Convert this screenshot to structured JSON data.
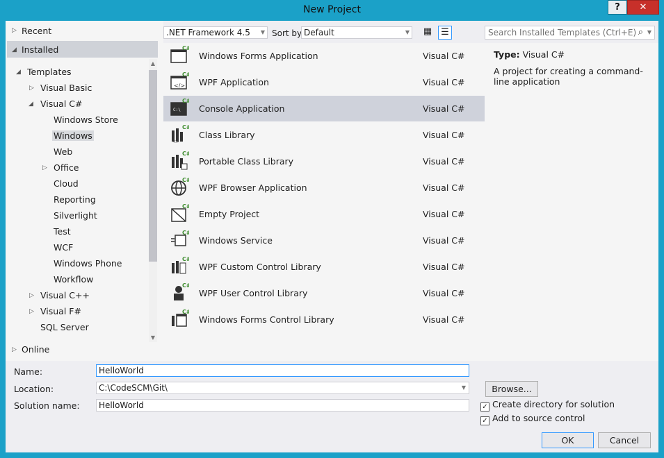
{
  "window": {
    "title": "New Project",
    "help_label": "?",
    "close_label": "✕"
  },
  "tree": {
    "recent": "Recent",
    "installed": "Installed",
    "templates": "Templates",
    "items": [
      {
        "label": "Visual Basic"
      },
      {
        "label": "Visual C#"
      },
      {
        "label": "Windows Store"
      },
      {
        "label": "Windows"
      },
      {
        "label": "Web"
      },
      {
        "label": "Office"
      },
      {
        "label": "Cloud"
      },
      {
        "label": "Reporting"
      },
      {
        "label": "Silverlight"
      },
      {
        "label": "Test"
      },
      {
        "label": "WCF"
      },
      {
        "label": "Windows Phone"
      },
      {
        "label": "Workflow"
      },
      {
        "label": "Visual C++"
      },
      {
        "label": "Visual F#"
      },
      {
        "label": "SQL Server"
      }
    ],
    "online": "Online"
  },
  "filter": {
    "framework": ".NET Framework 4.5",
    "sort_label": "Sort by:",
    "sort_value": "Default",
    "search_placeholder": "Search Installed Templates (Ctrl+E)"
  },
  "templates": [
    {
      "name": "Windows Forms Application",
      "lang": "Visual C#",
      "icon": "window-icon"
    },
    {
      "name": "WPF Application",
      "lang": "Visual C#",
      "icon": "wpf-window-icon"
    },
    {
      "name": "Console Application",
      "lang": "Visual C#",
      "icon": "console-icon"
    },
    {
      "name": "Class Library",
      "lang": "Visual C#",
      "icon": "library-icon"
    },
    {
      "name": "Portable Class Library",
      "lang": "Visual C#",
      "icon": "portable-library-icon"
    },
    {
      "name": "WPF Browser Application",
      "lang": "Visual C#",
      "icon": "globe-icon"
    },
    {
      "name": "Empty Project",
      "lang": "Visual C#",
      "icon": "empty-project-icon"
    },
    {
      "name": "Windows Service",
      "lang": "Visual C#",
      "icon": "service-icon"
    },
    {
      "name": "WPF Custom Control Library",
      "lang": "Visual C#",
      "icon": "custom-control-icon"
    },
    {
      "name": "WPF User Control Library",
      "lang": "Visual C#",
      "icon": "user-control-icon"
    },
    {
      "name": "Windows Forms Control Library",
      "lang": "Visual C#",
      "icon": "forms-control-icon"
    }
  ],
  "cs_badge": "C#",
  "details": {
    "type_label": "Type:",
    "type_value": "Visual C#",
    "description": "A project for creating a command-line application"
  },
  "form": {
    "name_label": "Name:",
    "name_value": "HelloWorld",
    "location_label": "Location:",
    "location_value": "C:\\CodeSCM\\Git\\",
    "solution_label": "Solution name:",
    "solution_value": "HelloWorld",
    "browse_label": "Browse...",
    "create_dir_label": "Create directory for solution",
    "source_control_label": "Add to source control",
    "ok_label": "OK",
    "cancel_label": "Cancel"
  },
  "colors": {
    "frame": "#1ba1c8",
    "selection": "#cfd2db",
    "accent": "#3399ff",
    "close": "#c7302a"
  }
}
